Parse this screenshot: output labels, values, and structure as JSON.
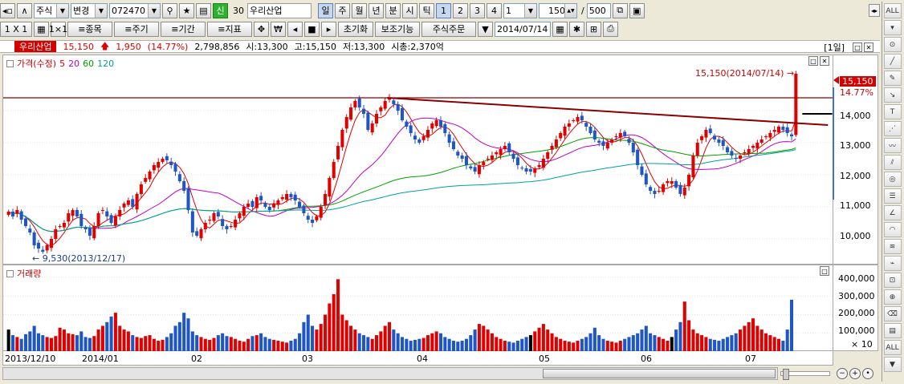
{
  "toolbar1": {
    "market": "주식",
    "action": "변경",
    "code": "072470",
    "new_badge": "신",
    "count": "30",
    "stock_name": "우리산업",
    "periods": [
      "일",
      "주",
      "월",
      "년",
      "분",
      "시",
      "틱"
    ],
    "intervals": [
      "1",
      "2",
      "3",
      "4"
    ],
    "interval_value": "1",
    "bars_shown": "150",
    "slash": "/",
    "bars_total": "500"
  },
  "toolbar2": {
    "layout": "1 X 1",
    "item_btn": "종목",
    "period_btn": "주기",
    "term_btn": "기간",
    "indicator_btn": "지표",
    "reset_btn": "초기화",
    "aux_btn": "보조기능",
    "order_btn": "주식주문",
    "date": "2014/07/14"
  },
  "infobar": {
    "name": "우리산업",
    "price": "15,150",
    "change": "1,950",
    "change_pct": "(14.77%)",
    "volume": "2,798,856",
    "open": "시:13,300",
    "high": "고:15,150",
    "low": "저:13,300",
    "mcap": "시총:2,370억",
    "period_label": "[1일]"
  },
  "price_pane": {
    "legend_title": "가격(수정)",
    "ma_labels": [
      "5",
      "20",
      "60",
      "120"
    ],
    "ma_colors": [
      "#e00000",
      "#c000c0",
      "#00a000",
      "#00a0a0"
    ],
    "high_annot": "15,150(2014/07/14)",
    "low_annot": "9,530(2013/12/17)",
    "current_price": "15,150",
    "current_pct": "14.77%",
    "axis_ticks": [
      "14,000",
      "13,000",
      "12,000",
      "11,000",
      "10,000"
    ]
  },
  "volume_pane": {
    "legend_title": "거래량",
    "axis_ticks": [
      "400,000",
      "300,000",
      "200,000",
      "100,000"
    ],
    "axis_unit": "× 10"
  },
  "date_axis": [
    "2013/12/10",
    "2014/01",
    "02",
    "03",
    "04",
    "05",
    "06",
    "07"
  ],
  "chart_data": {
    "type": "candlestick",
    "price_ylim": [
      9300,
      15600
    ],
    "volume_ylim": [
      0,
      430000
    ],
    "closes": [
      10850,
      10700,
      10900,
      10600,
      10400,
      10200,
      9800,
      9700,
      9600,
      9800,
      10000,
      10300,
      10400,
      10500,
      10800,
      10900,
      10700,
      10400,
      10300,
      10100,
      10400,
      10800,
      10900,
      10700,
      10500,
      10700,
      10900,
      11100,
      11200,
      11000,
      11400,
      11700,
      11900,
      12100,
      12300,
      12400,
      12500,
      12450,
      12300,
      12100,
      11800,
      11500,
      10900,
      10200,
      10100,
      10300,
      10500,
      10600,
      10800,
      10700,
      10400,
      10300,
      10400,
      10600,
      10800,
      11000,
      11100,
      11000,
      11300,
      11200,
      11000,
      10900,
      11100,
      11200,
      11300,
      11400,
      11300,
      11200,
      11000,
      10800,
      10600,
      10500,
      10700,
      11000,
      11400,
      11900,
      12400,
      12900,
      13400,
      13800,
      14100,
      14300,
      14100,
      13900,
      13400,
      13600,
      13900,
      14100,
      14300,
      14400,
      14200,
      14000,
      13700,
      13500,
      13300,
      13100,
      13000,
      13200,
      13400,
      13600,
      13700,
      13500,
      13300,
      13000,
      12800,
      12600,
      12500,
      12300,
      12200,
      12100,
      12300,
      12400,
      12500,
      12600,
      12700,
      12800,
      12900,
      12700,
      12500,
      12300,
      12200,
      12100,
      12100,
      12200,
      12300,
      12500,
      12700,
      12900,
      13100,
      13300,
      13500,
      13600,
      13700,
      13800,
      13700,
      13500,
      13300,
      13100,
      13000,
      12900,
      13000,
      13100,
      13200,
      13300,
      13200,
      13000,
      12700,
      12300,
      12000,
      11700,
      11500,
      11400,
      11500,
      11700,
      11800,
      11800,
      11600,
      11400,
      11600,
      12000,
      12600,
      13000,
      13200,
      13400,
      13300,
      13100,
      13000,
      12900,
      12700,
      12600,
      12500,
      12600,
      12700,
      12800,
      12900,
      13000,
      13100,
      13200,
      13300,
      13400,
      13500,
      13400,
      13300,
      13200,
      15150
    ],
    "volumes": [
      120000,
      90000,
      80000,
      70000,
      95000,
      110000,
      140000,
      100000,
      90000,
      80000,
      75000,
      85000,
      130000,
      120000,
      100000,
      95000,
      90000,
      110000,
      80000,
      75000,
      85000,
      120000,
      140000,
      160000,
      190000,
      210000,
      140000,
      120000,
      110000,
      90000,
      80000,
      75000,
      85000,
      90000,
      70000,
      60000,
      65000,
      80000,
      100000,
      140000,
      160000,
      210000,
      180000,
      110000,
      90000,
      80000,
      70000,
      65000,
      75000,
      90000,
      100000,
      85000,
      80000,
      70000,
      60000,
      55000,
      70000,
      85000,
      90000,
      100000,
      80000,
      70000,
      65000,
      60000,
      55000,
      50000,
      60000,
      70000,
      100000,
      160000,
      200000,
      140000,
      120000,
      150000,
      200000,
      260000,
      310000,
      390000,
      200000,
      170000,
      140000,
      120000,
      100000,
      90000,
      80000,
      70000,
      90000,
      110000,
      140000,
      160000,
      120000,
      100000,
      80000,
      70000,
      60000,
      65000,
      70000,
      75000,
      90000,
      100000,
      110000,
      100000,
      80000,
      70000,
      60000,
      55000,
      60000,
      70000,
      90000,
      120000,
      150000,
      140000,
      120000,
      100000,
      80000,
      70000,
      60000,
      55000,
      50000,
      60000,
      70000,
      80000,
      90000,
      110000,
      130000,
      150000,
      120000,
      100000,
      80000,
      70000,
      60000,
      55000,
      50000,
      60000,
      70000,
      80000,
      100000,
      130000,
      90000,
      70000,
      60000,
      55000,
      50000,
      60000,
      70000,
      80000,
      90000,
      100000,
      120000,
      140000,
      100000,
      90000,
      80000,
      70000,
      60000,
      80000,
      120000,
      160000,
      270000,
      170000,
      120000,
      100000,
      90000,
      80000,
      70000,
      65000,
      60000,
      70000,
      80000,
      90000,
      100000,
      120000,
      140000,
      160000,
      180000,
      140000,
      120000,
      100000,
      90000,
      80000,
      70000,
      60000,
      120000,
      280000
    ]
  }
}
